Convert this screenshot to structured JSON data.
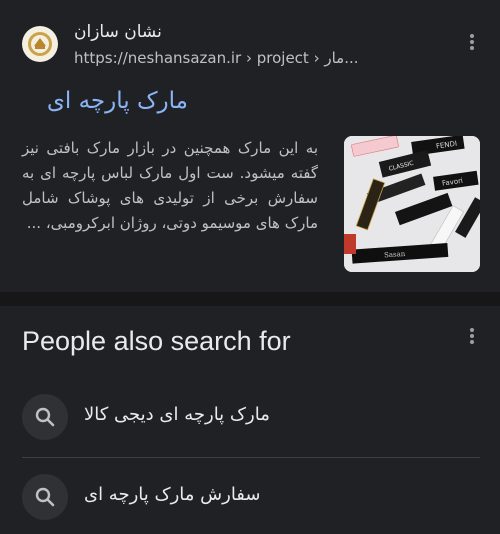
{
  "result": {
    "site_name": "نشان سازان",
    "url_domain": "https://neshansazan.ir",
    "url_path": " › project › مار...",
    "title": "مارک پارچه ای",
    "snippet": "به این مارک همچنین در بازار مارک بافتی نیز گفته میشود. ست اول مارک لباس پارچه ای به سفارش برخی از تولیدی های پوشاک شامل مارک های موسیمو دوتی، روژان ابرکرومبی، ...",
    "thumbnail_labels": [
      "CLASSIC",
      "FENDI",
      "Favori",
      "Sasan"
    ]
  },
  "people_also_search": {
    "heading": "People also search for",
    "items": [
      {
        "text": "مارک پارچه ای دیجی کالا"
      },
      {
        "text": "سفارش مارک پارچه ای"
      }
    ]
  },
  "colors": {
    "background": "#202124",
    "link": "#8ab4f8",
    "text": "#e8eaed",
    "muted": "#bdc1c6"
  },
  "icons": {
    "menu": "more-vert-icon",
    "search": "search-icon"
  }
}
